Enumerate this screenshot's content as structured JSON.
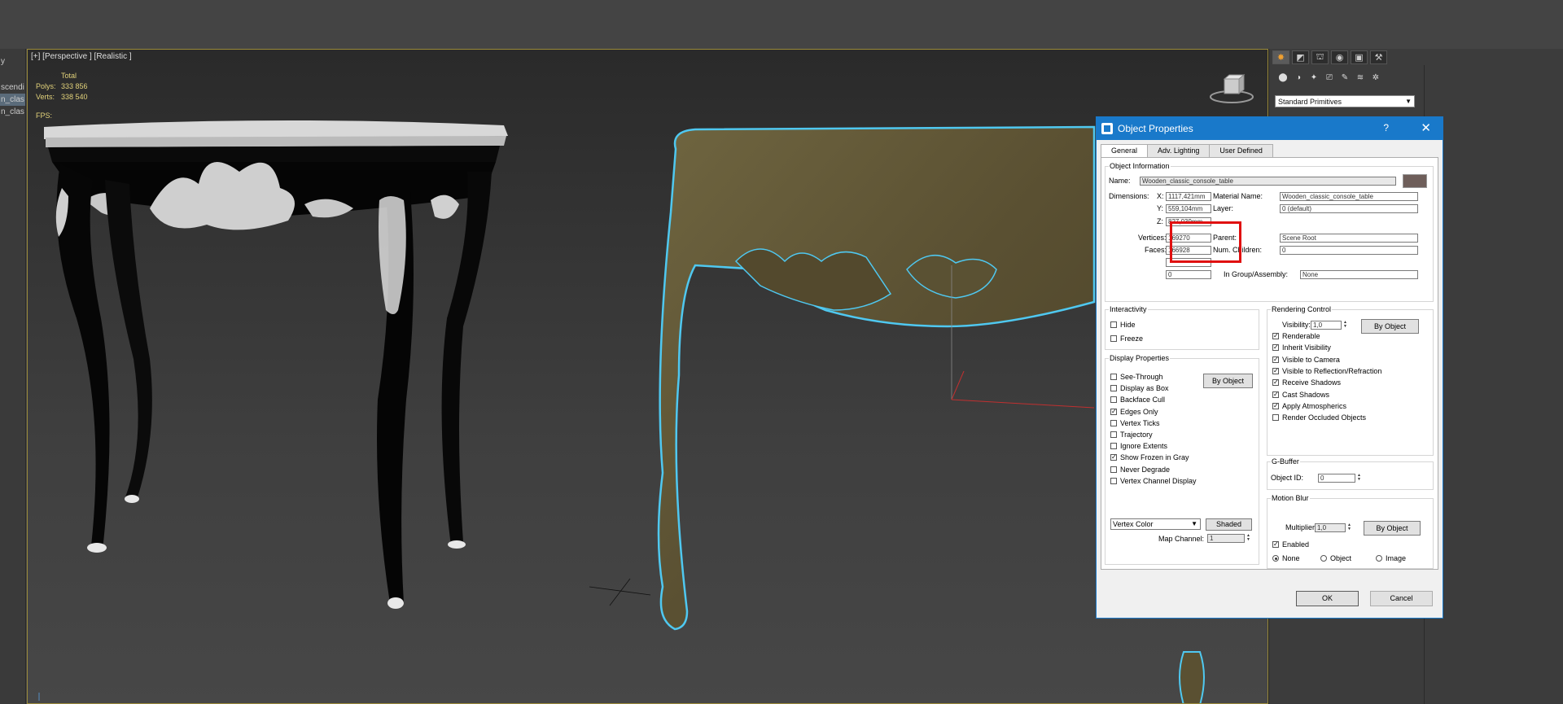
{
  "sidebar": {
    "items": [
      "y",
      "scendi",
      "n_clas",
      "n_clas"
    ]
  },
  "viewport": {
    "label": "[+] [Perspective ] [Realistic ]",
    "stats": {
      "header": "Total",
      "polys_label": "Polys:",
      "polys": "333 856",
      "verts_label": "Verts:",
      "verts": "338 540",
      "fps_label": "FPS:"
    }
  },
  "command_panel": {
    "primitives_dropdown": "Standard Primitives",
    "tab_icons": [
      "create-tab-icon",
      "modify-tab-icon",
      "hierarchy-tab-icon",
      "motion-tab-icon",
      "display-tab-icon",
      "utilities-tab-icon"
    ]
  },
  "dialog": {
    "title": "Object Properties",
    "help": "?",
    "close": "✕",
    "tabs": [
      "General",
      "Adv. Lighting",
      "User Defined"
    ],
    "object_info": {
      "legend": "Object Information",
      "name_label": "Name:",
      "name": "Wooden_classic_console_table",
      "dimensions_label": "Dimensions:",
      "x_label": "X:",
      "x": "1117,421mm",
      "y_label": "Y:",
      "y": "559,104mm",
      "z_label": "Z:",
      "z": "827,039mm",
      "material_label": "Material Name:",
      "material": "Wooden_classic_console_table",
      "layer_label": "Layer:",
      "layer": "0 (default)",
      "vertices_label": "Vertices:",
      "vertices": "169270",
      "faces_label": "Faces:",
      "faces": "166928",
      "parent_label": "Parent:",
      "parent": "Scene Root",
      "children_label": "Num. Children:",
      "children": "0",
      "extra_field": "0",
      "group_label": "In Group/Assembly:",
      "group": "None"
    },
    "interactivity": {
      "legend": "Interactivity",
      "items": [
        {
          "label": "Hide",
          "checked": false
        },
        {
          "label": "Freeze",
          "checked": false
        }
      ]
    },
    "display": {
      "legend": "Display Properties",
      "by_object": "By Object",
      "items": [
        {
          "label": "See-Through",
          "checked": false
        },
        {
          "label": "Display as Box",
          "checked": false
        },
        {
          "label": "Backface Cull",
          "checked": false
        },
        {
          "label": "Edges Only",
          "checked": true
        },
        {
          "label": "Vertex Ticks",
          "checked": false
        },
        {
          "label": "Trajectory",
          "checked": false
        },
        {
          "label": "Ignore Extents",
          "checked": false
        },
        {
          "label": "Show Frozen in Gray",
          "checked": true
        },
        {
          "label": "Never Degrade",
          "checked": false
        },
        {
          "label": "Vertex Channel Display",
          "checked": false
        }
      ],
      "vertex_color": "Vertex Color",
      "shaded": "Shaded",
      "map_channel_label": "Map Channel:",
      "map_channel": "1"
    },
    "rendering": {
      "legend": "Rendering Control",
      "visibility_label": "Visibility:",
      "visibility": "1,0",
      "by_object": "By Object",
      "items": [
        {
          "label": "Renderable",
          "checked": true
        },
        {
          "label": "Inherit Visibility",
          "checked": true
        },
        {
          "label": "Visible to Camera",
          "checked": true
        },
        {
          "label": "Visible to Reflection/Refraction",
          "checked": true
        },
        {
          "label": "Receive Shadows",
          "checked": true
        },
        {
          "label": "Cast Shadows",
          "checked": true
        },
        {
          "label": "Apply Atmospherics",
          "checked": true
        },
        {
          "label": "Render Occluded Objects",
          "checked": false
        }
      ]
    },
    "gbuffer": {
      "legend": "G-Buffer",
      "object_id_label": "Object ID:",
      "object_id": "0"
    },
    "motion_blur": {
      "legend": "Motion Blur",
      "multiplier_label": "Multiplier:",
      "multiplier": "1,0",
      "by_object": "By Object",
      "enabled_label": "Enabled",
      "enabled": true,
      "modes": [
        {
          "label": "None",
          "selected": true
        },
        {
          "label": "Object",
          "selected": false
        },
        {
          "label": "Image",
          "selected": false
        }
      ]
    },
    "ok": "OK",
    "cancel": "Cancel"
  },
  "colors": {
    "accent": "#1979ca",
    "selection_outline": "#4fc8f0",
    "wood": "#5f5535",
    "highlight_box": "#e01010",
    "object_color": "#6e5e5a"
  }
}
